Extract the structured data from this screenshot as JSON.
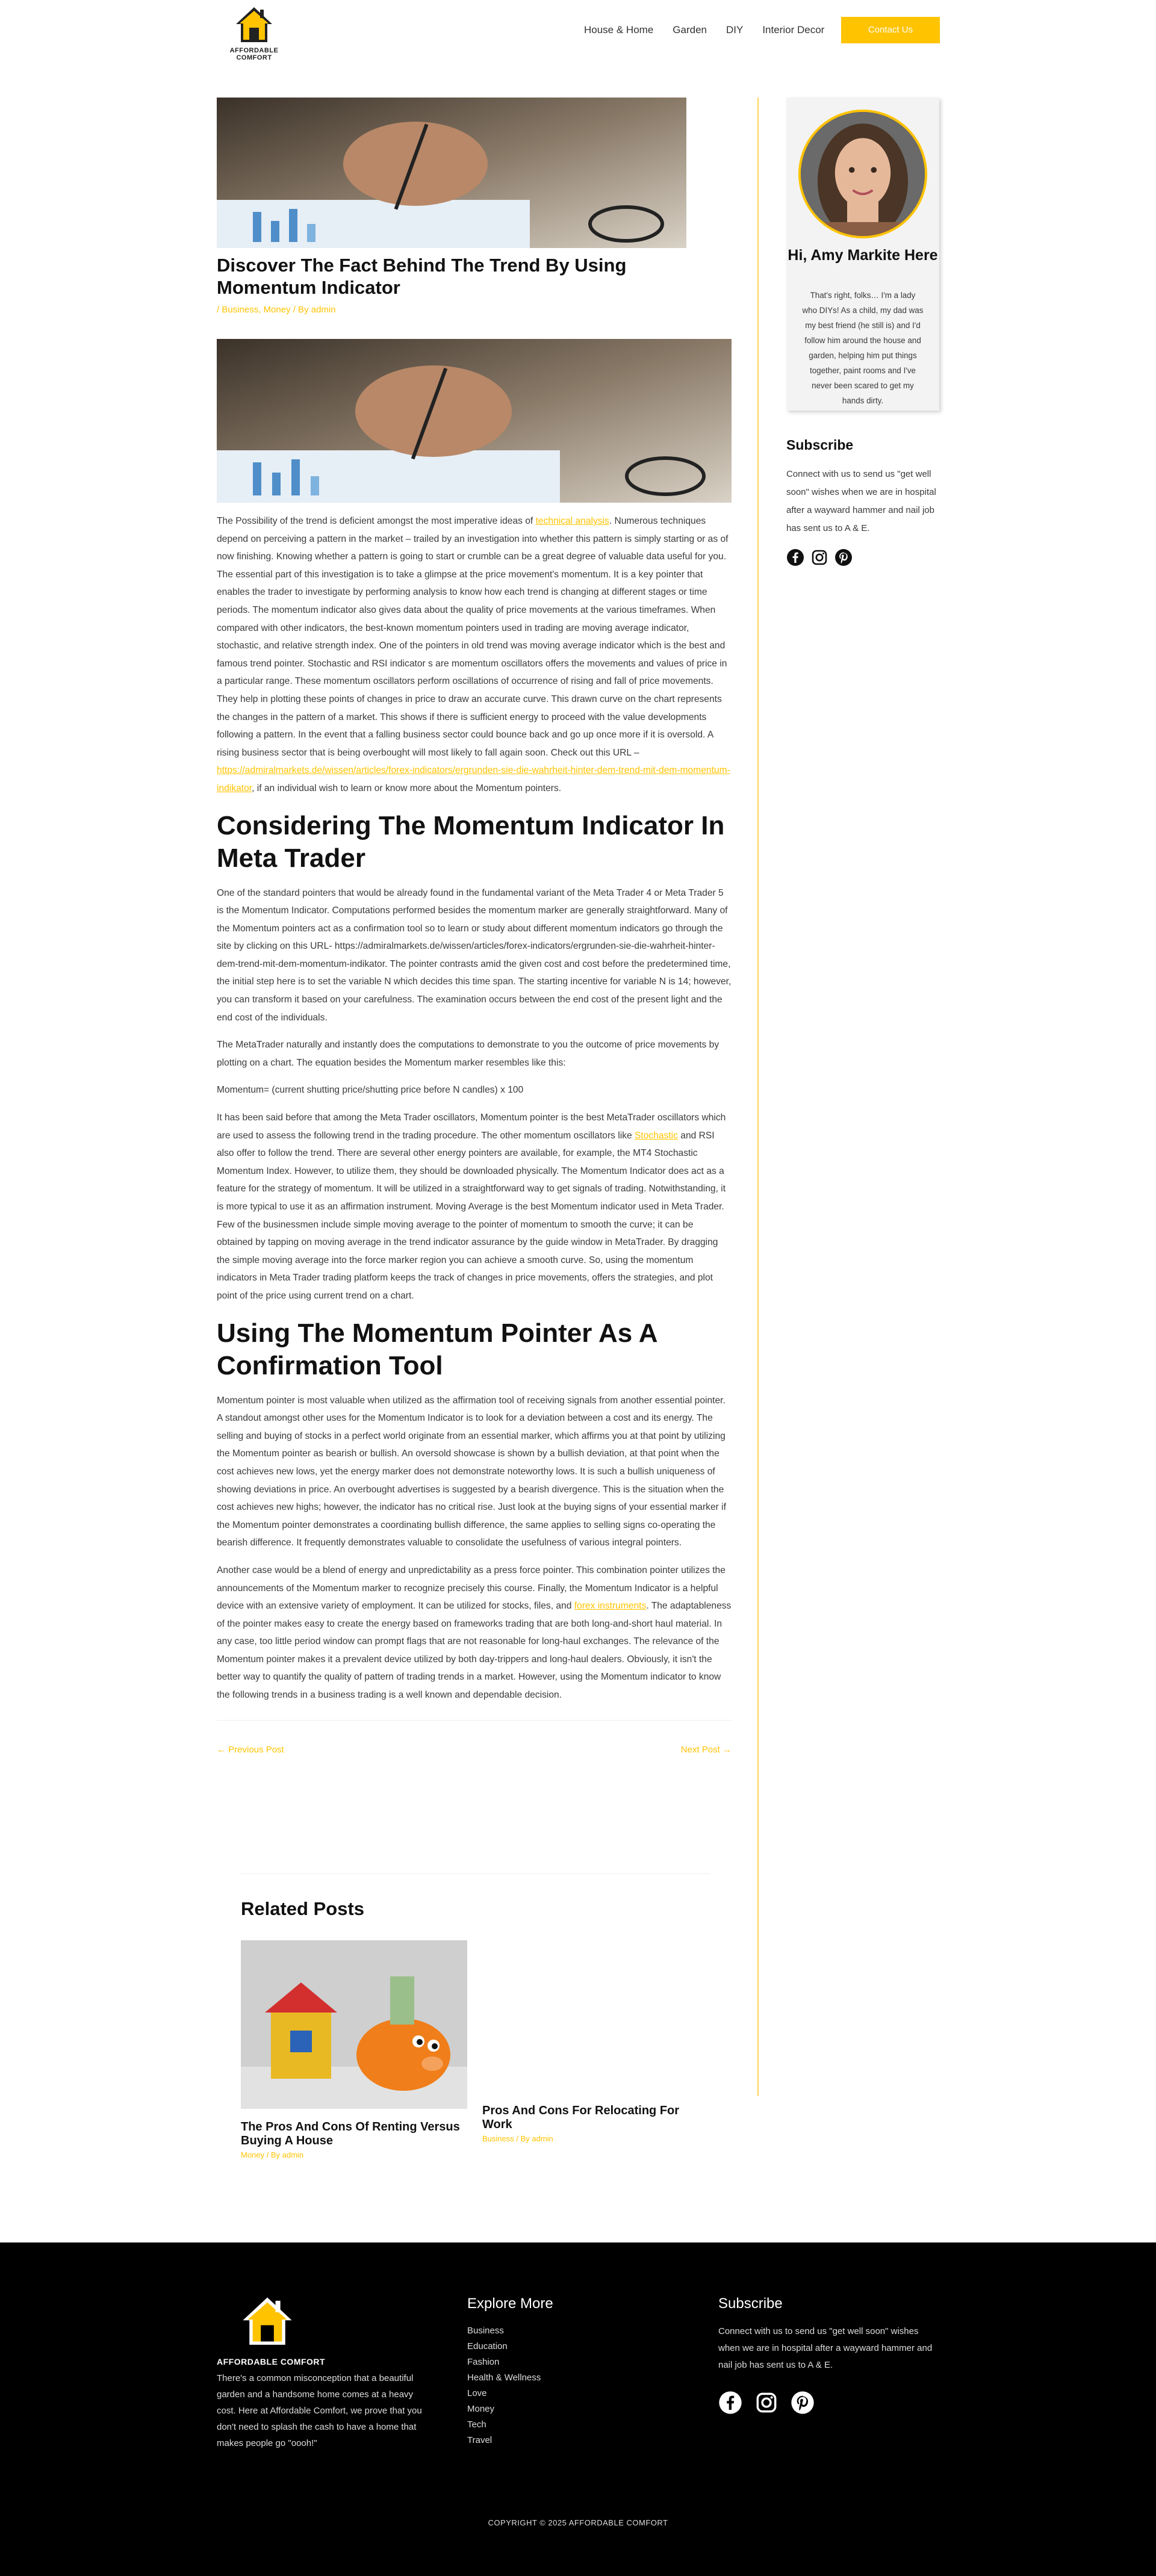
{
  "header": {
    "brand": "AFFORDABLE COMFORT",
    "nav": [
      "House & Home",
      "Garden",
      "DIY",
      "Interior Decor"
    ],
    "cta": "Contact Us"
  },
  "post": {
    "title": "Discover The Fact Behind The Trend By Using Momentum Indicator",
    "meta": "/ Business, Money / By admin",
    "p1_a": "The Possibility of the trend is deficient amongst the most imperative ideas of ",
    "p1_link1": "technical analysis",
    "p1_b": ". Numerous techniques depend on perceiving a pattern in the market – trailed by an investigation into whether this pattern is simply starting or as of now finishing. Knowing whether a pattern is going to start or crumble can be a great degree of valuable data useful for you. The essential part of this investigation is to take a glimpse at the price movement's momentum. It is a key pointer that enables the trader to investigate by performing analysis to know how each trend is changing at different stages or time periods. The momentum indicator also gives data about the quality of price movements at the various timeframes. When compared with other indicators, the best-known momentum pointers used in trading are moving average indicator, stochastic, and relative strength index. One of the pointers in old trend was moving average indicator which is the best and famous trend pointer. Stochastic and RSI indicator s are momentum oscillators offers the movements and values of price in a particular range. These momentum oscillators perform oscillations of occurrence of rising and fall of price movements. They help in plotting these points of changes in price to draw an accurate curve. This drawn curve on the chart represents the changes in the pattern of a market. This shows if there is sufficient energy to proceed with the value developments following a pattern. In the event that a falling business sector could bounce back and go up once more if it is oversold. A rising business sector that is being overbought will most likely to fall again soon. Check out this URL – ",
    "p1_link2": "https://admiralmarkets.de/wissen/articles/forex-indicators/ergrunden-sie-die-wahrheit-hinter-dem-trend-mit-dem-momentum-indikator",
    "p1_c": ", if an individual wish to learn or know more about the Momentum pointers.",
    "h2_1": "Considering The Momentum Indicator In Meta Trader",
    "p2": "One of the standard pointers that would be already found in the fundamental variant of the Meta Trader 4 or Meta Trader 5 is the Momentum Indicator. Computations performed besides the momentum marker are generally straightforward. Many of the Momentum pointers act as a confirmation tool so to learn or study about different momentum indicators go through the site by clicking on this URL- https://admiralmarkets.de/wissen/articles/forex-indicators/ergrunden-sie-die-wahrheit-hinter-dem-trend-mit-dem-momentum-indikator. The pointer contrasts amid the given cost and cost before the predetermined time, the initial step here is to set the variable N which decides this time span. The starting incentive for variable N is 14; however, you can transform it based on your carefulness. The examination occurs between the end cost of the present light and the end cost of the individuals.",
    "p3": "The MetaTrader naturally and instantly does the computations to demonstrate to you the outcome of price movements by plotting on a chart. The equation besides the Momentum marker resembles like this:",
    "p4": "Momentum= (current shutting price/shutting price before N candles) x 100",
    "p5_a": "It has been said before that among the Meta Trader oscillators, Momentum pointer is the best MetaTrader oscillators which are used to assess the following trend in the trading procedure. The other momentum oscillators like ",
    "p5_link": "Stochastic",
    "p5_b": " and RSI also offer to follow the trend. There are several other energy pointers are available, for example, the MT4 Stochastic Momentum Index. However, to utilize them, they should be downloaded physically. The Momentum Indicator does act as a feature for the strategy of momentum. It will be utilized in a straightforward way to get signals of trading. Notwithstanding, it is more typical to use it as an affirmation instrument. Moving Average is the best Momentum indicator used in Meta Trader. Few of the businessmen include simple moving average to the pointer of momentum to smooth the curve; it can be obtained by tapping on moving average in the trend indicator assurance by the guide window in MetaTrader. By dragging the simple moving average into the force marker region you can achieve a smooth curve. So, using the momentum indicators in Meta Trader trading platform keeps the track of changes in price movements, offers the strategies, and plot point of the price using current trend on a chart.",
    "h2_2": "Using The Momentum Pointer As A Confirmation Tool",
    "p6": "Momentum pointer is most valuable when utilized as the affirmation tool of receiving signals from another essential pointer. A standout amongst other uses for the Momentum Indicator is to look for a deviation between a cost and its energy. The selling and buying of stocks in a perfect world originate from an essential marker, which affirms you at that point by utilizing the Momentum pointer as bearish or bullish. An oversold showcase is shown by a bullish deviation, at that point when the cost achieves new lows, yet the energy marker does not demonstrate noteworthy lows. It is such a bullish uniqueness of showing deviations in price. An overbought advertises is suggested by a bearish divergence. This is the situation when the cost achieves new highs; however, the indicator has no critical rise. Just look at the buying signs of your essential marker if the Momentum pointer demonstrates a coordinating bullish difference, the same applies to selling signs co-operating the bearish difference. It frequently demonstrates valuable to consolidate the usefulness of various integral pointers.",
    "p7_a": "Another case would be a blend of energy and unpredictability as a press force pointer. This combination pointer utilizes the announcements of the Momentum marker to recognize precisely this course. Finally, the Momentum Indicator is a helpful device with an extensive variety of employment. It can be utilized for stocks, files, and ",
    "p7_link": "forex instruments",
    "p7_b": ". The adaptableness of the pointer makes easy to create the energy based on frameworks trading that are both long-and-short haul material. In any case, too little period window can prompt flags that are not reasonable for long-haul exchanges. The relevance of the Momentum pointer makes it a prevalent device utilized by both day-trippers and long-haul dealers. Obviously, it isn't the better way to quantify the quality of pattern of trading trends in a market. However, using the Momentum indicator to know the following trends in a business trading is a well known and dependable decision.",
    "prev": "← Previous Post",
    "next": "Next Post →"
  },
  "related": {
    "title": "Related Posts",
    "items": [
      {
        "title": "The Pros And Cons Of Renting Versus Buying A House",
        "meta": "Money / By admin"
      },
      {
        "title": "Pros And Cons For Relocating For Work",
        "meta": "Business / By admin"
      }
    ]
  },
  "sidebar": {
    "name": "Hi, Amy Markite Here",
    "bio": "That's right, folks… I'm a lady who DIYs! As a child, my dad was my best friend (he still is) and I'd follow him around the house and garden, helping him put things together, paint rooms and I've never been scared to get my hands dirty.",
    "subscribe_title": "Subscribe",
    "subscribe_text": "Connect with us to send us \"get well soon\" wishes when we are in hospital after a wayward hammer and nail job has sent us to A & E."
  },
  "footer": {
    "brand": "AFFORDABLE COMFORT",
    "desc": "There's a common misconception that a beautiful garden and a handsome home comes at a heavy cost. Here at Affordable Comfort, we prove that you don't need to splash the cash to have a home that makes people go \"oooh!\"",
    "explore_title": "Explore More",
    "explore": [
      "Business",
      "Education",
      "Fashion",
      "Health & Wellness",
      "Love",
      "Money",
      "Tech",
      "Travel"
    ],
    "subscribe_title": "Subscribe",
    "subscribe_text": "Connect with us to send us \"get well soon\" wishes when we are in hospital after a wayward hammer and nail job has sent us to A & E.",
    "copyright": "COPYRIGHT © 2025 AFFORDABLE COMFORT"
  },
  "colors": {
    "accent": "#ffc300",
    "footer_bg": "#000000"
  }
}
